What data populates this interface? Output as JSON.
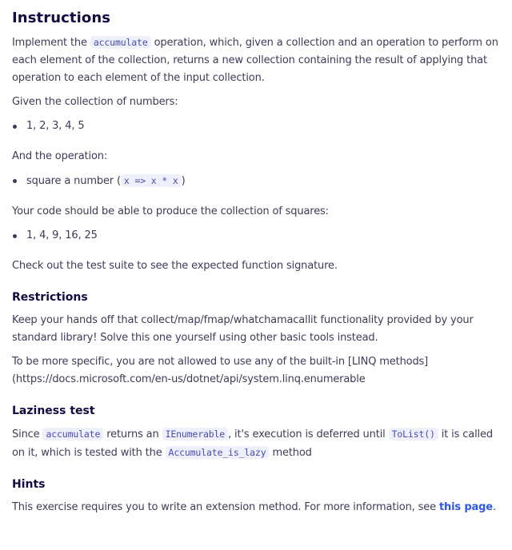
{
  "title": "Instructions",
  "intro": {
    "pre": "Implement the ",
    "code": "accumulate",
    "post": " operation, which, given a collection and an operation to perform on each element of the collection, returns a new collection containing the result of applying that operation to each element of the input collection."
  },
  "given_numbers_label": "Given the collection of numbers:",
  "numbers_item": "1, 2, 3, 4, 5",
  "operation_label": "And the operation:",
  "operation_item": {
    "pre": "square a number (",
    "code": "x => x * x",
    "post": ")"
  },
  "produce_label": "Your code should be able to produce the collection of squares:",
  "squares_item": "1, 4, 9, 16, 25",
  "test_suite_text": "Check out the test suite to see the expected function signature.",
  "restrictions": {
    "heading": "Restrictions",
    "p1": "Keep your hands off that collect/map/fmap/whatchamacallit functionality provided by your standard library! Solve this one yourself using other basic tools instead.",
    "p2": "To be more specific, you are not allowed to use any of the built-in [LINQ methods](https://docs.microsoft.com/en-us/dotnet/api/system.linq.enumerable"
  },
  "laziness": {
    "heading": "Laziness test",
    "t1": "Since ",
    "c1": "accumulate",
    "t2": " returns an ",
    "c2": "IEnumerable",
    "t3": ", it's execution is deferred until ",
    "c3": "ToList()",
    "t4": " it is called on it, which is tested with the ",
    "c4": "Accumulate_is_lazy",
    "t5": " method"
  },
  "hints": {
    "heading": "Hints",
    "text": "This exercise requires you to write an extension method. For more information, see ",
    "link_text": "this page",
    "end": "."
  },
  "colors": {
    "heading": "#130b43",
    "body_text": "#3f3a5a",
    "code_bg": "#eef0fb",
    "code_text": "#4a4ab0",
    "link": "#2e57e8"
  }
}
